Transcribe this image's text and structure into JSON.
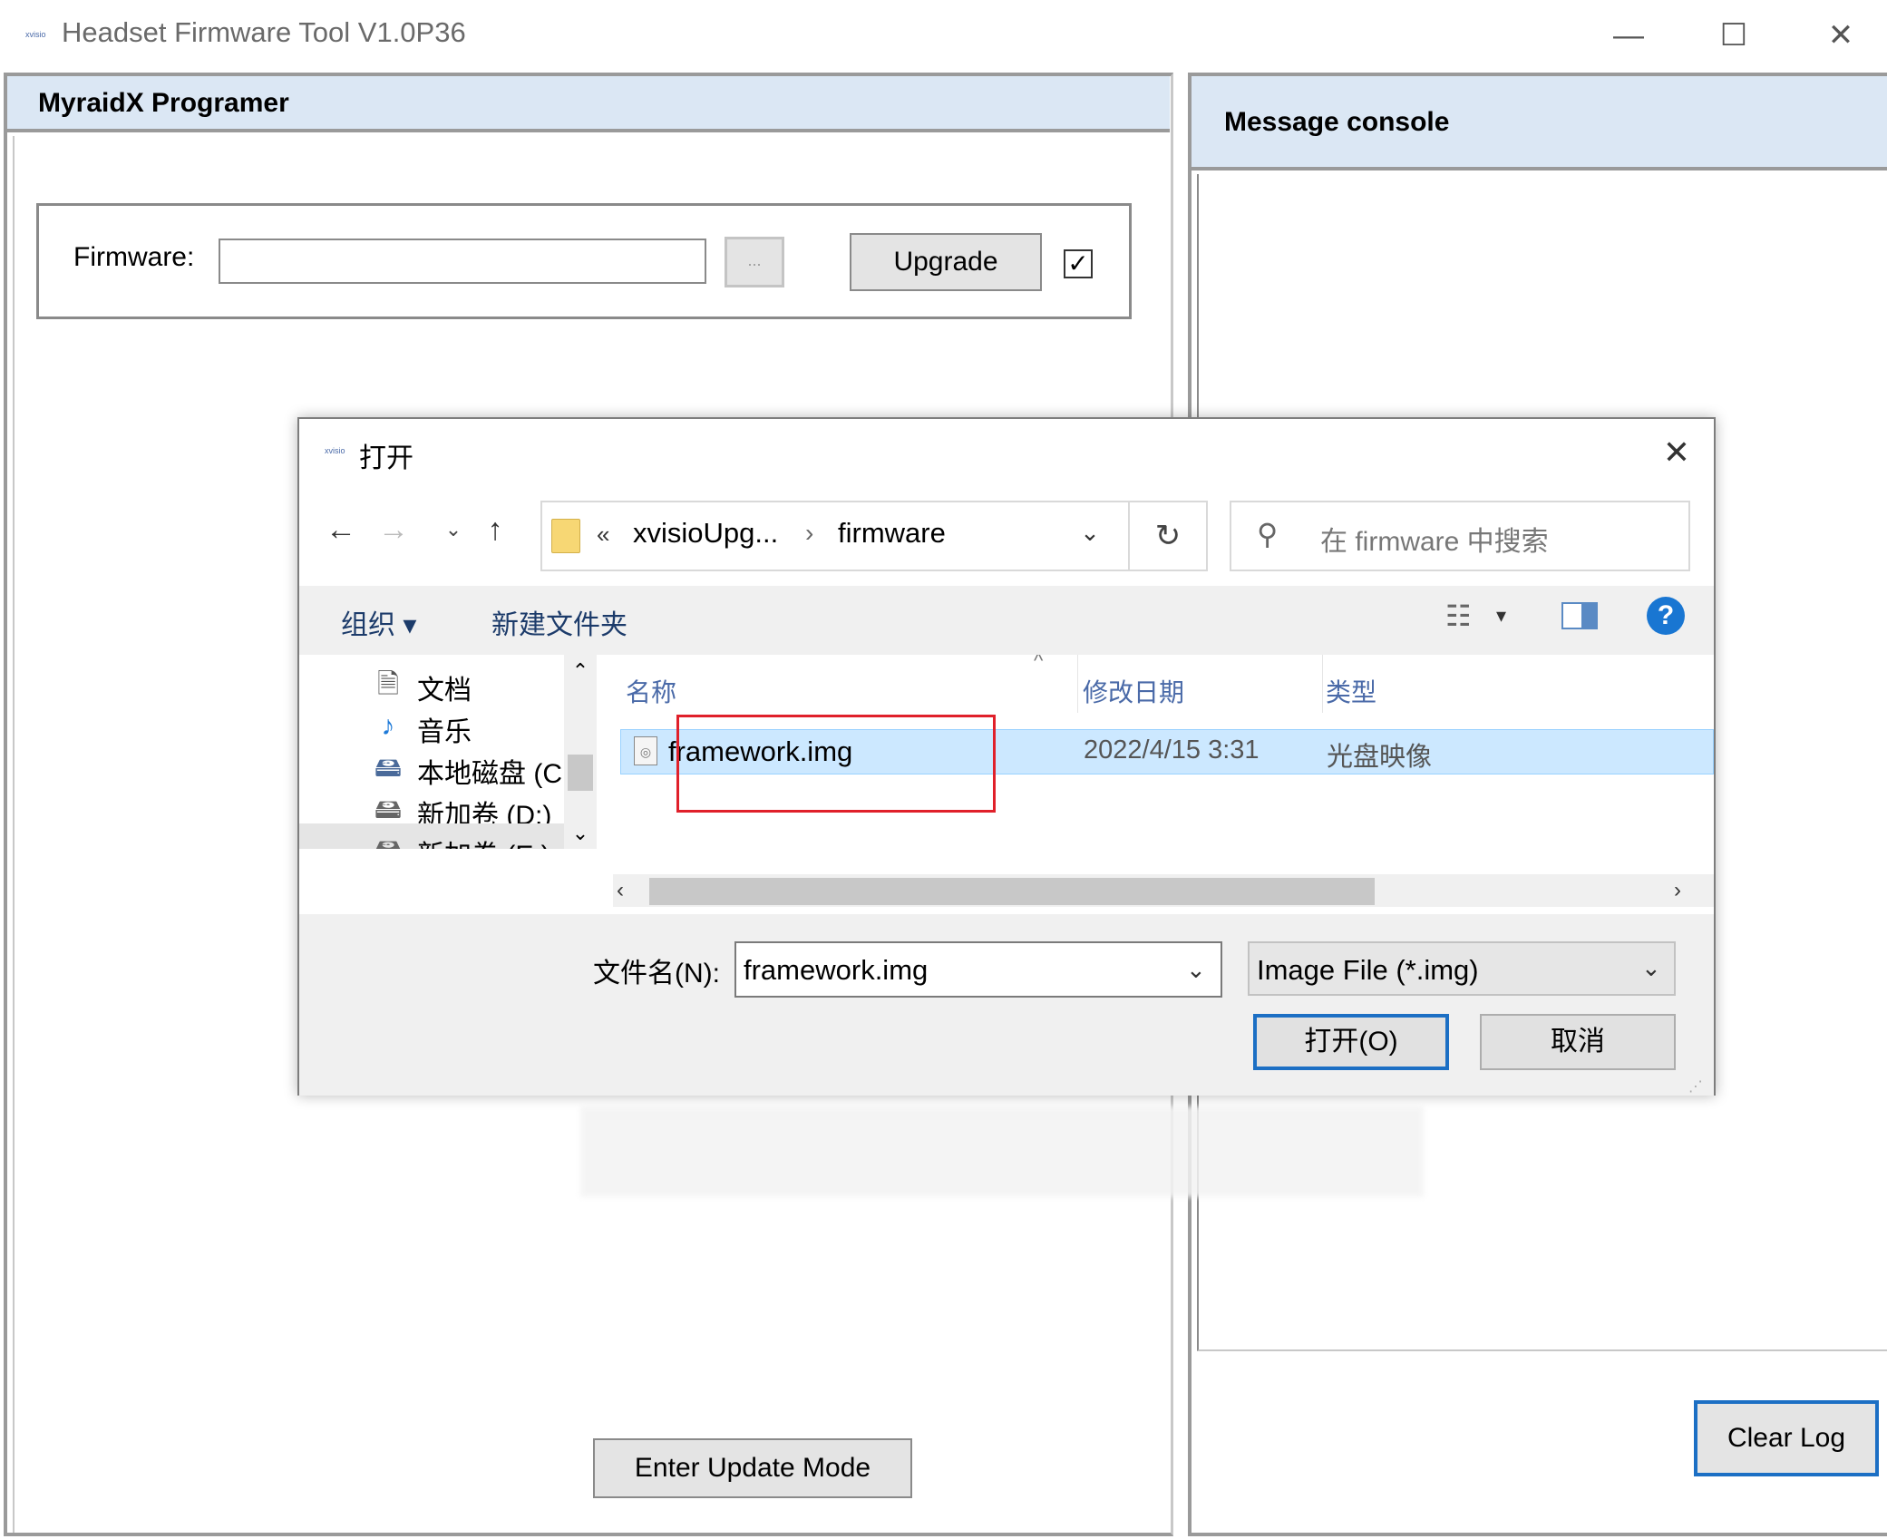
{
  "window": {
    "title": "Headset Firmware Tool V1.0P36",
    "icon": "xvisio-logo-icon",
    "minimize": "—",
    "maximize": "☐",
    "close": "✕"
  },
  "left_panel": {
    "title": "MyraidX Programer",
    "firmware_label": "Firmware:",
    "firmware_value": "",
    "browse_label": "...",
    "upgrade_label": "Upgrade",
    "checkbox_checked": true,
    "checkbox_mark": "✓",
    "enter_update_label": "Enter Update Mode"
  },
  "right_panel": {
    "title": "Message console",
    "clear_log_label": "Clear Log"
  },
  "dialog": {
    "title": "打开",
    "close": "✕",
    "nav": {
      "back": "←",
      "forward": "→",
      "recent": "⌄",
      "up": "↑"
    },
    "address": {
      "overflow": "«",
      "crumbs": [
        "xvisioUpg...",
        "firmware"
      ],
      "separator": "›",
      "dropdown": "⌄",
      "refresh": "↻"
    },
    "search": {
      "icon": "search-icon",
      "placeholder": "在 firmware 中搜索"
    },
    "toolbar": {
      "organize": "组织 ▾",
      "new_folder": "新建文件夹",
      "view_icon": "view-list-icon",
      "view_drop": "▾",
      "preview_icon": "preview-pane-icon",
      "help": "?"
    },
    "tree": [
      {
        "icon": "document-icon",
        "glyph": "🗎",
        "label": "文档"
      },
      {
        "icon": "music-icon",
        "glyph": "♪",
        "label": "音乐"
      },
      {
        "icon": "drive-icon",
        "glyph": "🖴",
        "label": "本地磁盘 (C:)"
      },
      {
        "icon": "drive-icon",
        "glyph": "🖴",
        "label": "新加卷 (D:)"
      },
      {
        "icon": "drive-icon",
        "glyph": "🖴",
        "label": "新加卷 (E:)"
      }
    ],
    "tree_scroll": {
      "up": "⌃",
      "down": "⌄"
    },
    "columns": {
      "name": "名称",
      "date": "修改日期",
      "type": "类型",
      "sort": "^"
    },
    "files": [
      {
        "name": "framework.img",
        "date": "2022/4/15 3:31",
        "type": "光盘映像"
      }
    ],
    "hscroll": {
      "left": "‹",
      "right": "›"
    },
    "filename_label": "文件名(N):",
    "filename_value": "framework.img",
    "filename_drop": "⌄",
    "filetype_value": "Image File (*.img)",
    "filetype_drop": "⌄",
    "open_label": "打开(O)",
    "cancel_label": "取消",
    "highlight_color": "#e0202a",
    "accent_color": "#1c6fc4"
  }
}
